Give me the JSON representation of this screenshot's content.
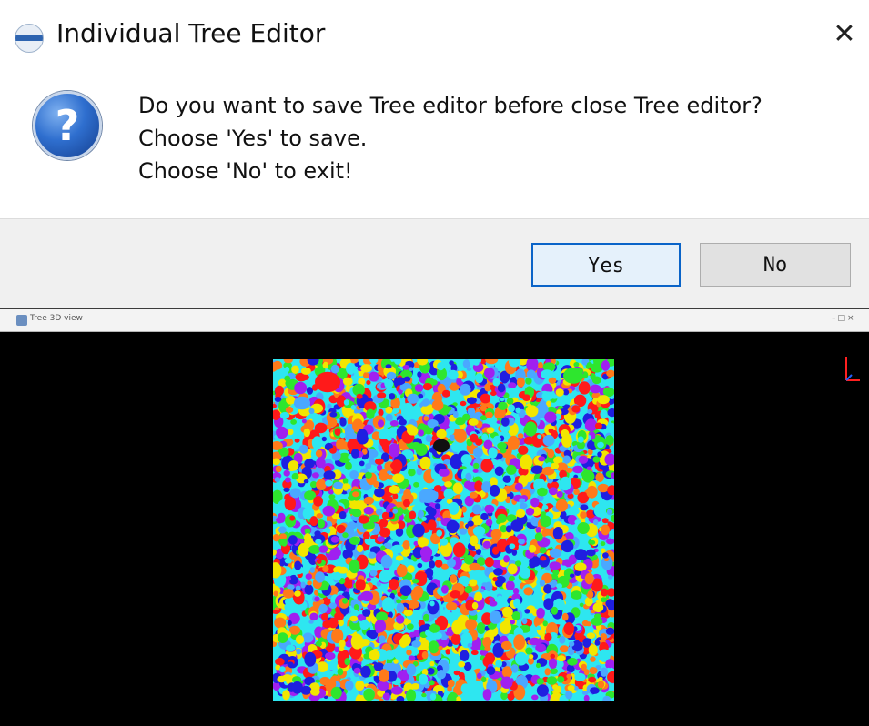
{
  "dialog": {
    "title": "Individual Tree Editor",
    "close_symbol": "✕",
    "icon": "question-icon",
    "question_mark": "?",
    "message_lines": [
      "Do you want to save Tree editor before close Tree editor?",
      "Choose 'Yes' to save.",
      "Choose 'No' to exit!"
    ],
    "buttons": {
      "yes": "Yes",
      "no": "No"
    }
  },
  "viewer": {
    "title": "Tree 3D view",
    "controls": "–□×",
    "segment_colors": [
      "#f2e600",
      "#2ee6f0",
      "#ff1a1a",
      "#1f1fe0",
      "#2ee62e",
      "#a020f0",
      "#ff7a1a",
      "#4aa8ff",
      "#e6e6e6"
    ],
    "axis_colors": {
      "x": "#ff2020",
      "y": "#2060ff",
      "z": "#ff2020"
    }
  }
}
